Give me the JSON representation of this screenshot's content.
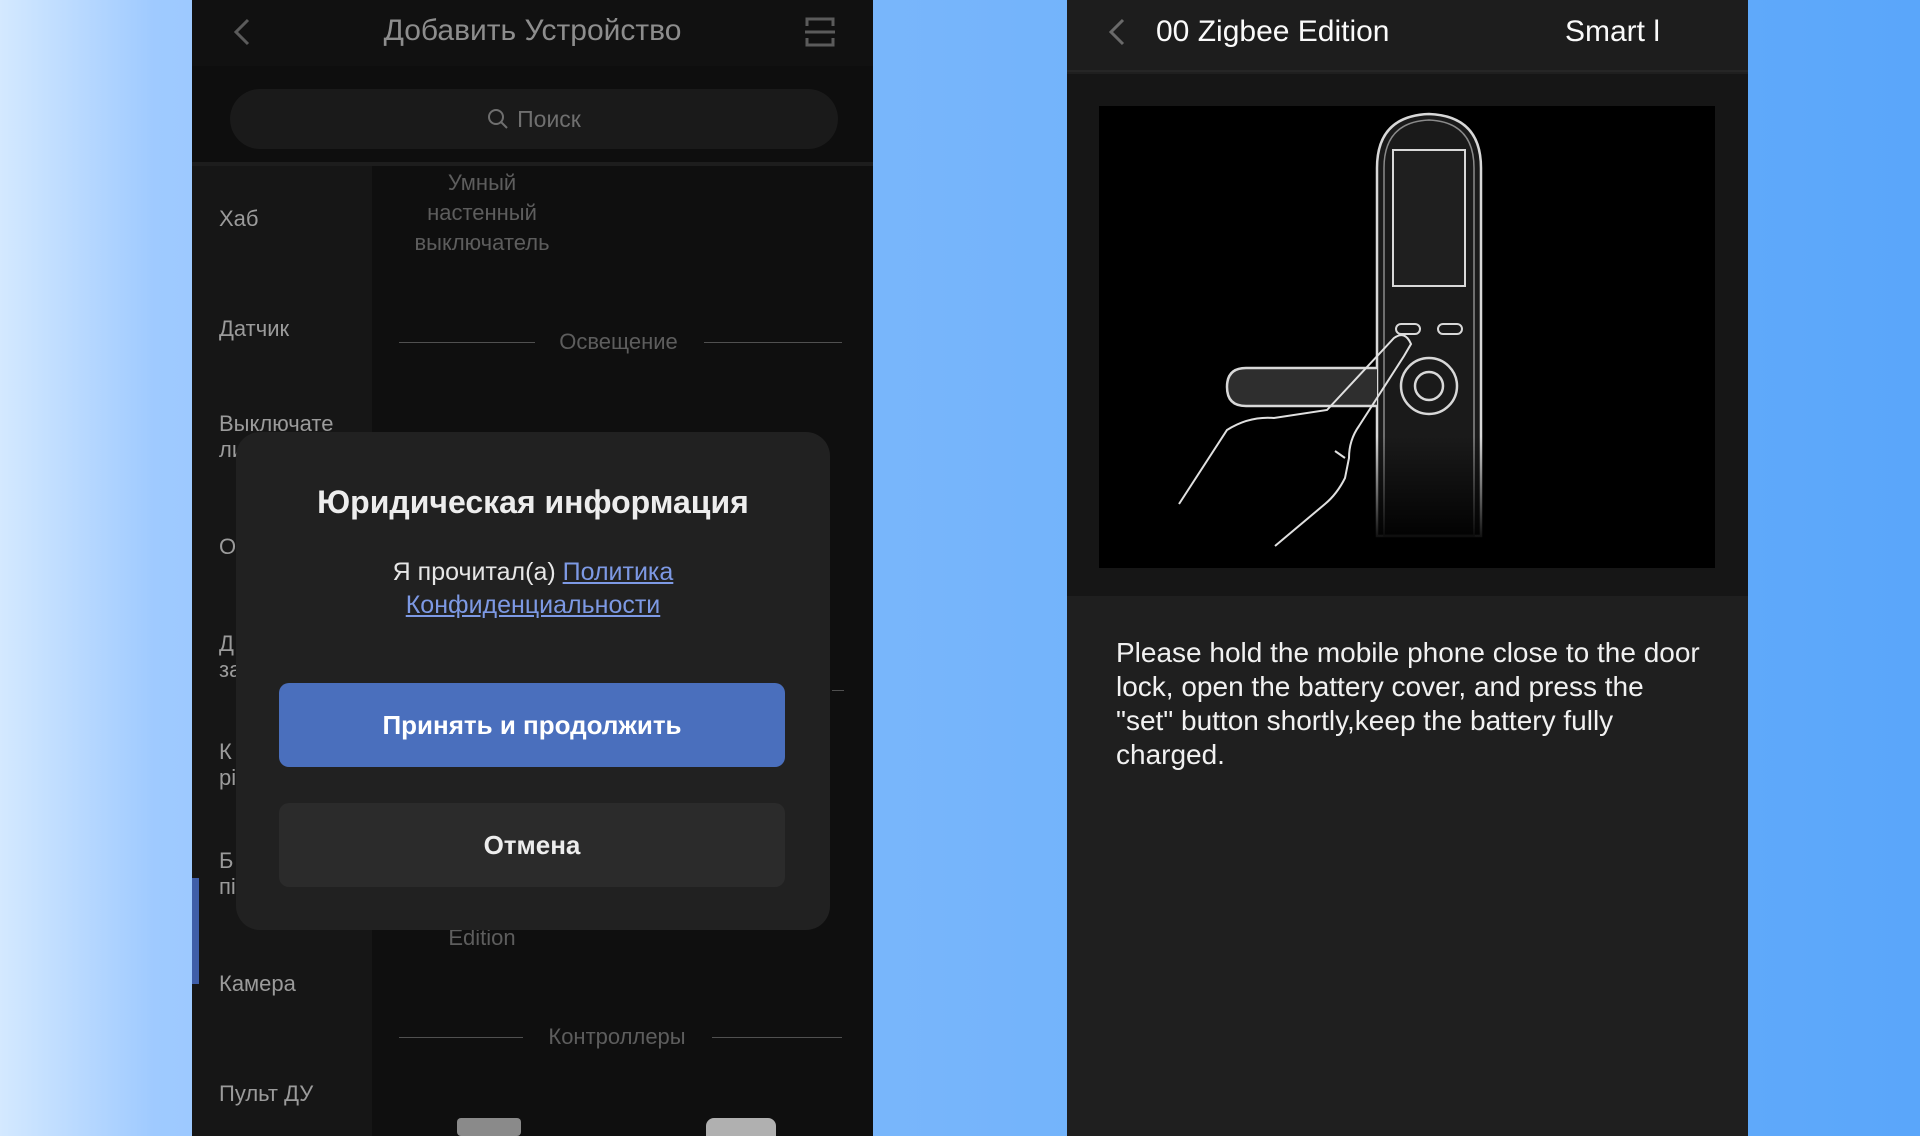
{
  "left_screen": {
    "title": "Добавить Устройство",
    "search_placeholder": "Поиск",
    "categories": [
      {
        "label": "Хаб"
      },
      {
        "label": "Датчик"
      },
      {
        "label": "Выключате\nли"
      },
      {
        "label": "О"
      },
      {
        "label": "Д\nза"
      },
      {
        "label": "К\nрі"
      },
      {
        "label": "Б\nпі"
      },
      {
        "label": "Камера"
      },
      {
        "label": "Пульт ДУ"
      }
    ],
    "content": {
      "device_top_label": "Умный\nнастенный\nвыключатель",
      "section_lighting": "Освещение",
      "device_bottom_label": "Edition",
      "section_controllers": "Контроллеры"
    },
    "dialog": {
      "title": "Юридическая информация",
      "body_prefix": "Я прочитал(а) ",
      "body_link": "Политика Конфиденциальности",
      "accept_label": "Принять и продолжить",
      "cancel_label": "Отмена"
    }
  },
  "right_screen": {
    "title": "00 Zigbee Edition",
    "title_right": "Smart l",
    "instruction": "Please hold the mobile phone close to the door lock, open the battery cover, and press the \"set\" button shortly,keep the battery fully charged."
  }
}
